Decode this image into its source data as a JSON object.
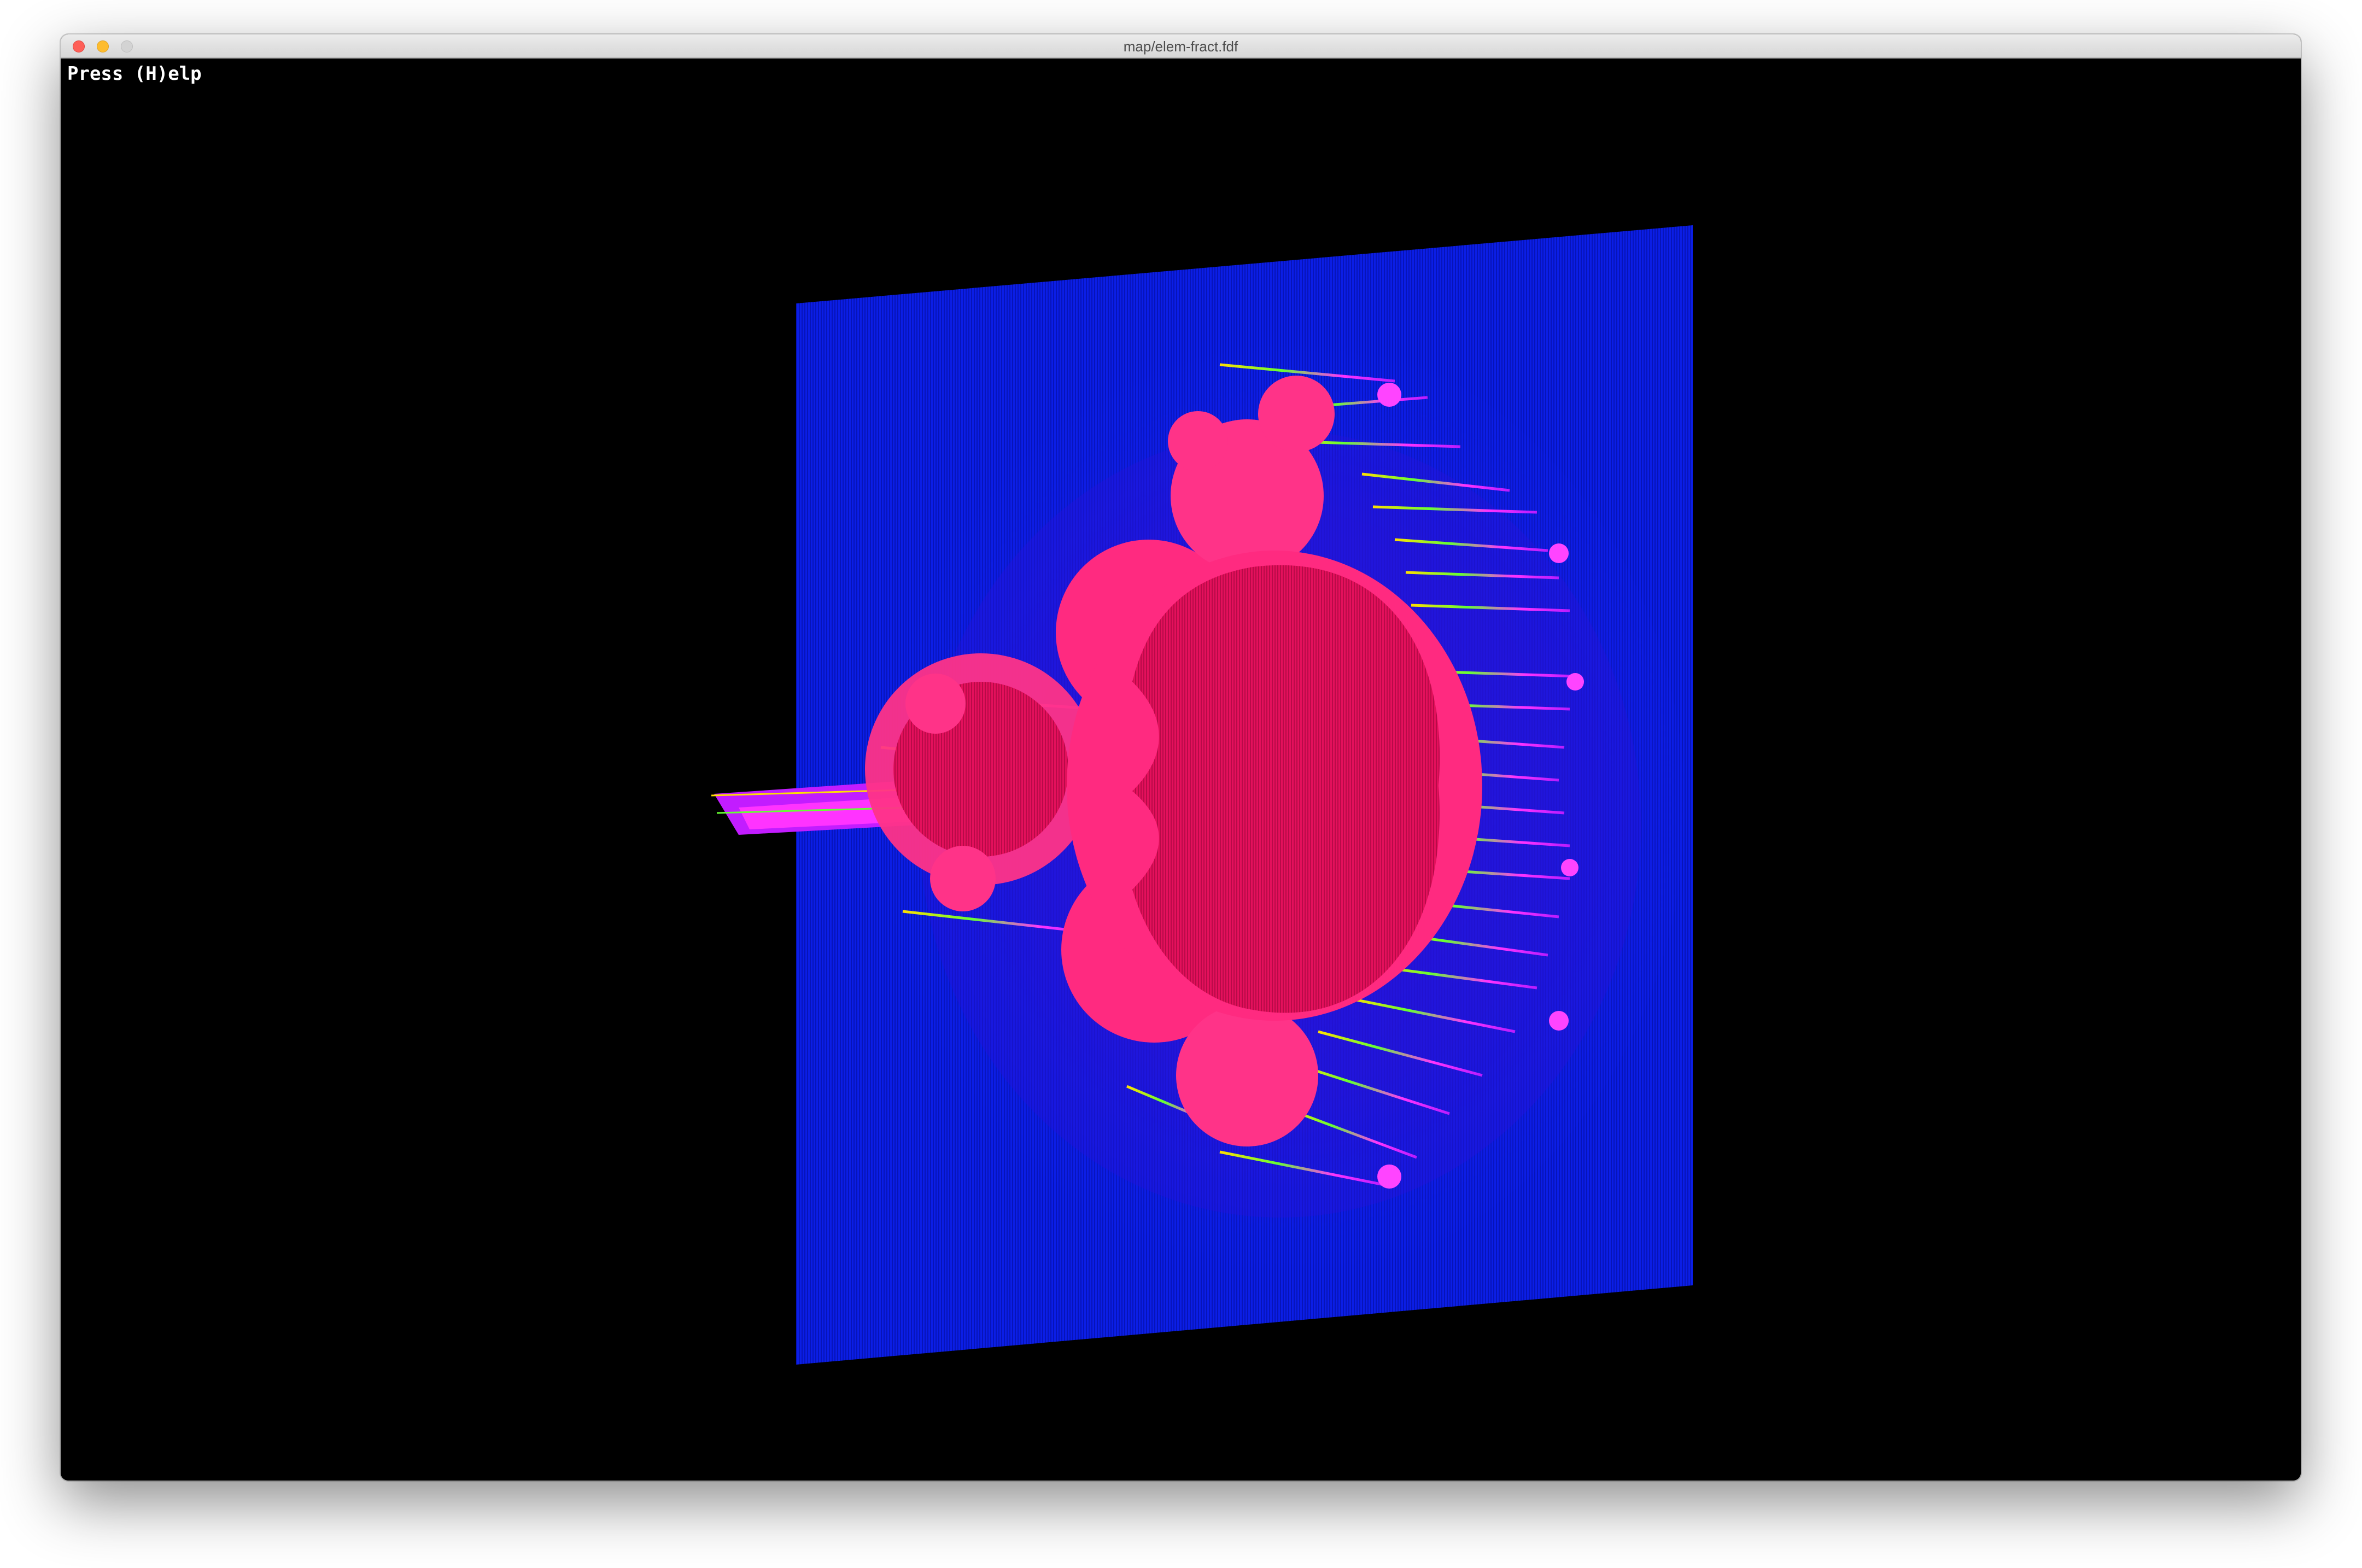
{
  "window": {
    "title": "map/elem-fract.fdf"
  },
  "overlay": {
    "help_hint": "Press (H)elp"
  },
  "icons": {
    "close": "close-icon",
    "minimize": "minimize-icon",
    "zoom": "zoom-icon"
  },
  "colors": {
    "background": "#000000",
    "plane_blue": "#0a1fe0",
    "fractal_body": "#e0105a",
    "fractal_edge": "#ff2a80",
    "spikes_magenta": "#ff33ff",
    "spikes_green": "#66ff33",
    "spikes_yellow": "#ffe000"
  }
}
